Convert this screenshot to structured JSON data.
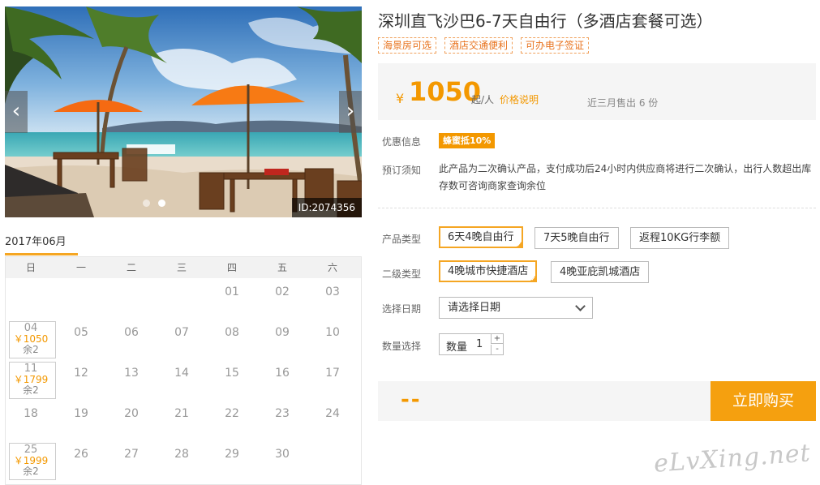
{
  "hero": {
    "image_id": "ID:2074356",
    "prev_icon": "chevron-left-icon",
    "next_icon": "chevron-right-icon",
    "slide_count": 2,
    "active_slide": 1
  },
  "calendar": {
    "month": "2017年06月",
    "weekdays": [
      "日",
      "一",
      "二",
      "三",
      "四",
      "五",
      "六"
    ],
    "rows": [
      [
        {
          "d": ""
        },
        {
          "d": ""
        },
        {
          "d": ""
        },
        {
          "d": ""
        },
        {
          "d": "01"
        },
        {
          "d": "02"
        },
        {
          "d": "03"
        }
      ],
      [
        {
          "d": "04",
          "price": "￥1050",
          "stock": "余2"
        },
        {
          "d": "05"
        },
        {
          "d": "06"
        },
        {
          "d": "07"
        },
        {
          "d": "08"
        },
        {
          "d": "09"
        },
        {
          "d": "10"
        }
      ],
      [
        {
          "d": "11",
          "price": "￥1799",
          "stock": "余2"
        },
        {
          "d": "12"
        },
        {
          "d": "13"
        },
        {
          "d": "14"
        },
        {
          "d": "15"
        },
        {
          "d": "16"
        },
        {
          "d": "17"
        }
      ],
      [
        {
          "d": "18"
        },
        {
          "d": "19"
        },
        {
          "d": "20"
        },
        {
          "d": "21"
        },
        {
          "d": "22"
        },
        {
          "d": "23"
        },
        {
          "d": "24"
        }
      ],
      [
        {
          "d": "25",
          "price": "￥1999",
          "stock": "余2"
        },
        {
          "d": "26"
        },
        {
          "d": "27"
        },
        {
          "d": "28"
        },
        {
          "d": "29"
        },
        {
          "d": "30"
        },
        {
          "d": ""
        }
      ]
    ],
    "accent_color": "#f5a623"
  },
  "product": {
    "title": "深圳直飞沙巴6-7天自由行（多酒店套餐可选）",
    "tags": [
      "海景房可选",
      "酒店交通便利",
      "可办电子签证"
    ],
    "price": {
      "currency": "¥",
      "amount": "1050",
      "unit": "起/人",
      "explain": "价格说明",
      "sold": "近三月售出 6 份"
    },
    "discount": {
      "label": "优惠信息",
      "badge": "蜂蜜抵10%"
    },
    "notice": {
      "label": "预订须知",
      "text": "此产品为二次确认产品，支付成功后24小时内供应商将进行二次确认，出行人数超出库存数可咨询商家查询余位"
    },
    "product_type": {
      "label": "产品类型",
      "options": [
        "6天4晚自由行",
        "7天5晚自由行",
        "返程10KG行李额"
      ],
      "selected": 0
    },
    "sub_type": {
      "label": "二级类型",
      "options": [
        "4晚城市快捷酒店",
        "4晚亚庇凯城酒店"
      ],
      "selected": 0
    },
    "date": {
      "label": "选择日期",
      "value": "请选择日期"
    },
    "quantity": {
      "label": "数量选择",
      "field_label": "数量",
      "value": "1",
      "plus": "+",
      "minus": "-"
    },
    "total": "--",
    "buy_label": "立即购买",
    "accent_color": "#f39800"
  },
  "watermark": "eLvXing.net"
}
